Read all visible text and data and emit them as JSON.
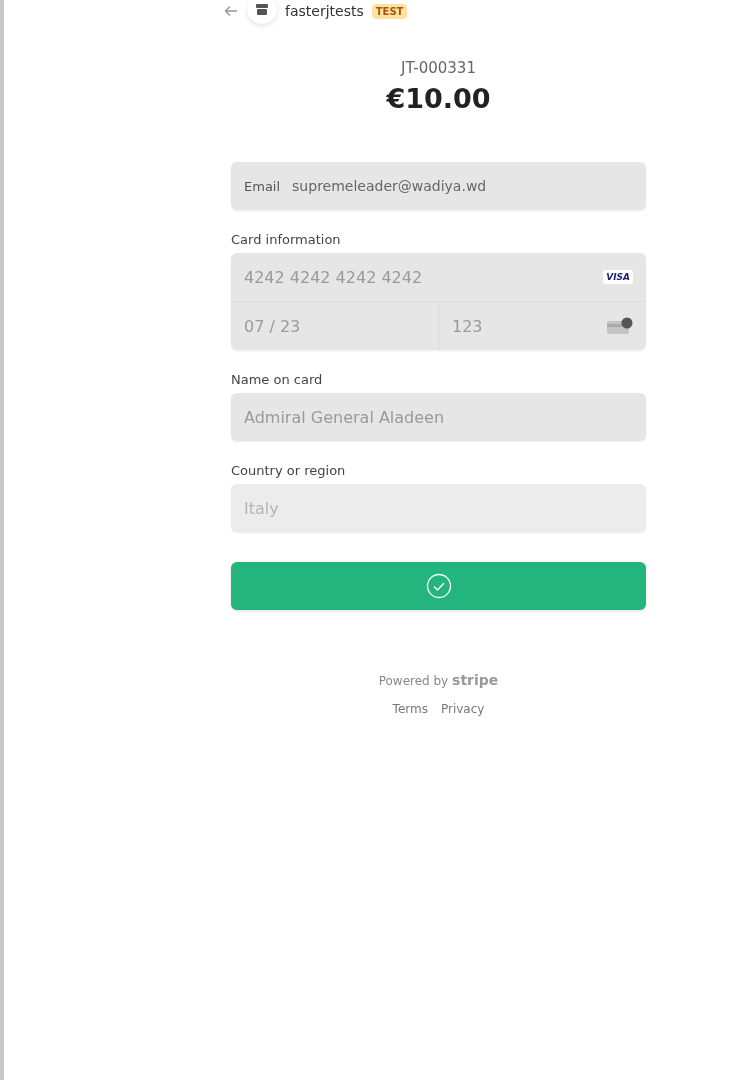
{
  "header": {
    "merchant": "fasterjtests",
    "badge": "TEST"
  },
  "order": {
    "id": "JT-000331",
    "amount": "€10.00"
  },
  "email": {
    "label": "Email",
    "value": "supremeleader@wadiya.wd"
  },
  "card": {
    "label": "Card information",
    "number": "4242 4242 4242 4242",
    "brand": "VISA",
    "expiry": "07 / 23",
    "cvc": "123"
  },
  "name": {
    "label": "Name on card",
    "value": "Admiral General Aladeen"
  },
  "country": {
    "label": "Country or region",
    "value": "Italy"
  },
  "pay_button": {
    "complete": true
  },
  "footer": {
    "powered_by": "Powered by",
    "brand": "stripe",
    "links": [
      "Terms",
      "Privacy"
    ]
  }
}
